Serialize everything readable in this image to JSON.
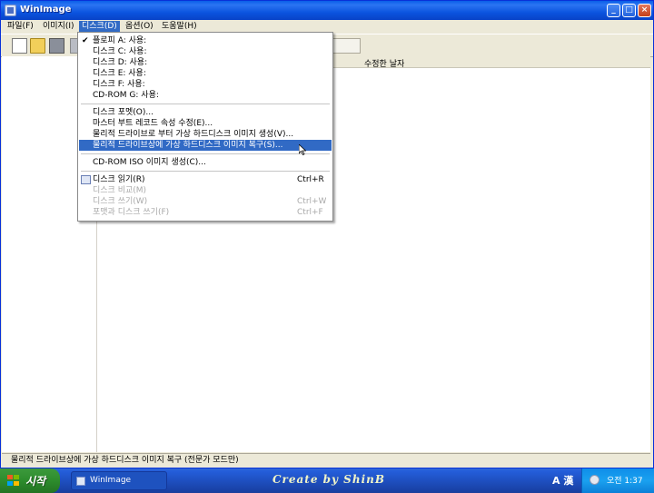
{
  "window": {
    "title": "WinImage"
  },
  "menubar": [
    {
      "label": "파일(F)"
    },
    {
      "label": "이미지(I)"
    },
    {
      "label": "디스크(D)"
    },
    {
      "label": "옵션(O)"
    },
    {
      "label": "도움말(H)"
    }
  ],
  "list": {
    "column_modified": "수정한 날자"
  },
  "disk_menu": {
    "drives": [
      {
        "label": "플로피 A: 사용:",
        "checked": true
      },
      {
        "label": "디스크 C: 사용:"
      },
      {
        "label": "디스크 D: 사용:"
      },
      {
        "label": "디스크 E: 사용:"
      },
      {
        "label": "디스크 F: 사용:"
      },
      {
        "label": "CD-ROM G: 사용:"
      }
    ],
    "actions": [
      {
        "label": "디스크 포멧(O)..."
      },
      {
        "label": "마스터 부트 레코드 속성 수정(E)..."
      },
      {
        "label": "물리적 드라이브로 부터 가상 하드디스크 이미지 생성(V)..."
      },
      {
        "label": "물리적 드라이브상에 가상 하드디스크 이미지 복구(S)...",
        "highlighted": true
      }
    ],
    "iso": {
      "label": "CD-ROM ISO 이미지 생성(C)..."
    },
    "disk_ops": [
      {
        "label": "디스크 읽기(R)",
        "shortcut": "Ctrl+R",
        "enabled": true
      },
      {
        "label": "디스크 비교(M)",
        "shortcut": "",
        "enabled": false
      },
      {
        "label": "디스크 쓰기(W)",
        "shortcut": "Ctrl+W",
        "enabled": false
      },
      {
        "label": "포맷과 디스크 쓰기(F)",
        "shortcut": "Ctrl+F",
        "enabled": false
      }
    ]
  },
  "statusbar": {
    "text": "물리적 드라이브상에 가상 하드디스크 이미지 복구 (전문가 모드만)"
  },
  "taskbar": {
    "start_label": "시작",
    "task_label": "WinImage",
    "credit": "Create by ShinB",
    "ime": "A 漢",
    "clock": "오전 1:37"
  },
  "colors": {
    "highlight": "#316ac5",
    "titlebar": "#0a53de",
    "menu_bg": "#ece9d8"
  }
}
